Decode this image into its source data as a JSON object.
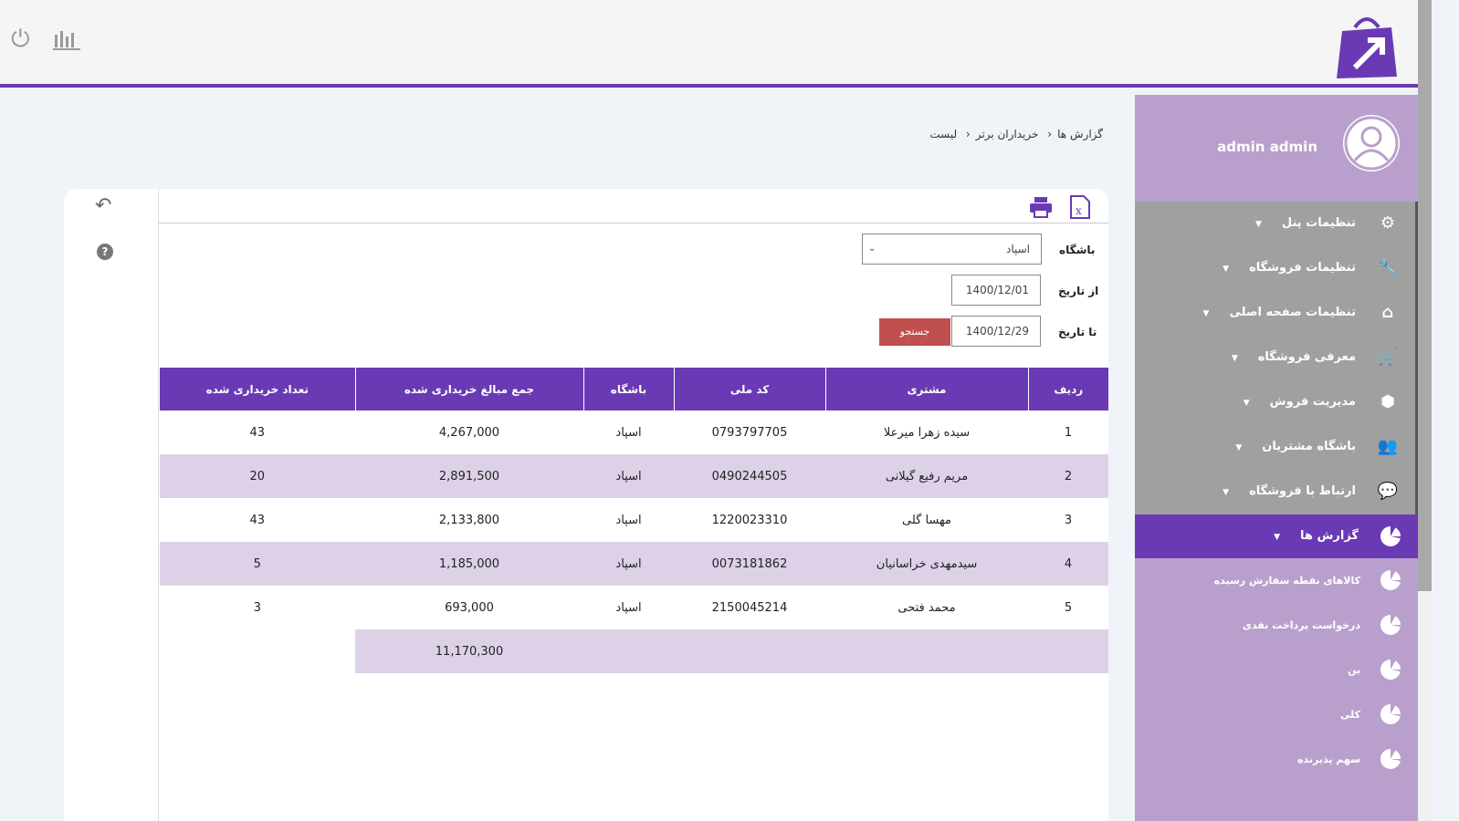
{
  "header": {
    "power_icon": "power-icon",
    "stats_icon": "bar-chart-icon"
  },
  "user": {
    "name": "admin admin"
  },
  "menu": [
    {
      "label": "تنظیمات پنل",
      "icon": "⚙"
    },
    {
      "label": "تنظیمات فروشگاه",
      "icon": "🔧"
    },
    {
      "label": "تنظیمات صفحه اصلی",
      "icon": "⌂"
    },
    {
      "label": "معرفی فروشگاه",
      "icon": "🛒"
    },
    {
      "label": "مدیریت فروش",
      "icon": "⬢"
    },
    {
      "label": "باشگاه مشتریان",
      "icon": "👥"
    },
    {
      "label": "ارتباط با فروشگاه",
      "icon": "💬"
    },
    {
      "label": "گزارش ها",
      "active": true
    }
  ],
  "submenu": [
    "کالاهای نقطه سفارش رسیده",
    "درخواست پرداخت نقدی",
    "بن",
    "کلی",
    "سهم پذیرنده"
  ],
  "breadcrumb": [
    "گزارش ها",
    "خریداران برتر",
    "لیست"
  ],
  "filters": {
    "club_label": "باشگاه",
    "club_value": "اسپاد",
    "from_label": "از تاریخ",
    "from_value": "1400/12/01",
    "to_label": "تا تاریخ",
    "to_value": "1400/12/29",
    "search_label": "جستجو"
  },
  "table": {
    "headers": [
      "ردیف",
      "مشتری",
      "کد ملی",
      "باشگاه",
      "جمع مبالغ خریداری شده",
      "تعداد خریداری شده"
    ],
    "rows": [
      [
        "1",
        "سیده زهرا میرعلا",
        "0793797705",
        "اسپاد",
        "4,267,000",
        "43"
      ],
      [
        "2",
        "مریم رفیع گیلانی",
        "0490244505",
        "اسپاد",
        "2,891,500",
        "20"
      ],
      [
        "3",
        "مهسا گلی",
        "1220023310",
        "اسپاد",
        "2,133,800",
        "43"
      ],
      [
        "4",
        "سیدمهدی خراسانیان",
        "0073181862",
        "اسپاد",
        "1,185,000",
        "5"
      ],
      [
        "5",
        "محمد فتحی",
        "2150045214",
        "اسپاد",
        "693,000",
        "3"
      ]
    ],
    "total": "11,170,300"
  },
  "colors": {
    "primary": "#6a3ab5",
    "sidebar": "#b9a0cc",
    "search": "#c0504d"
  }
}
